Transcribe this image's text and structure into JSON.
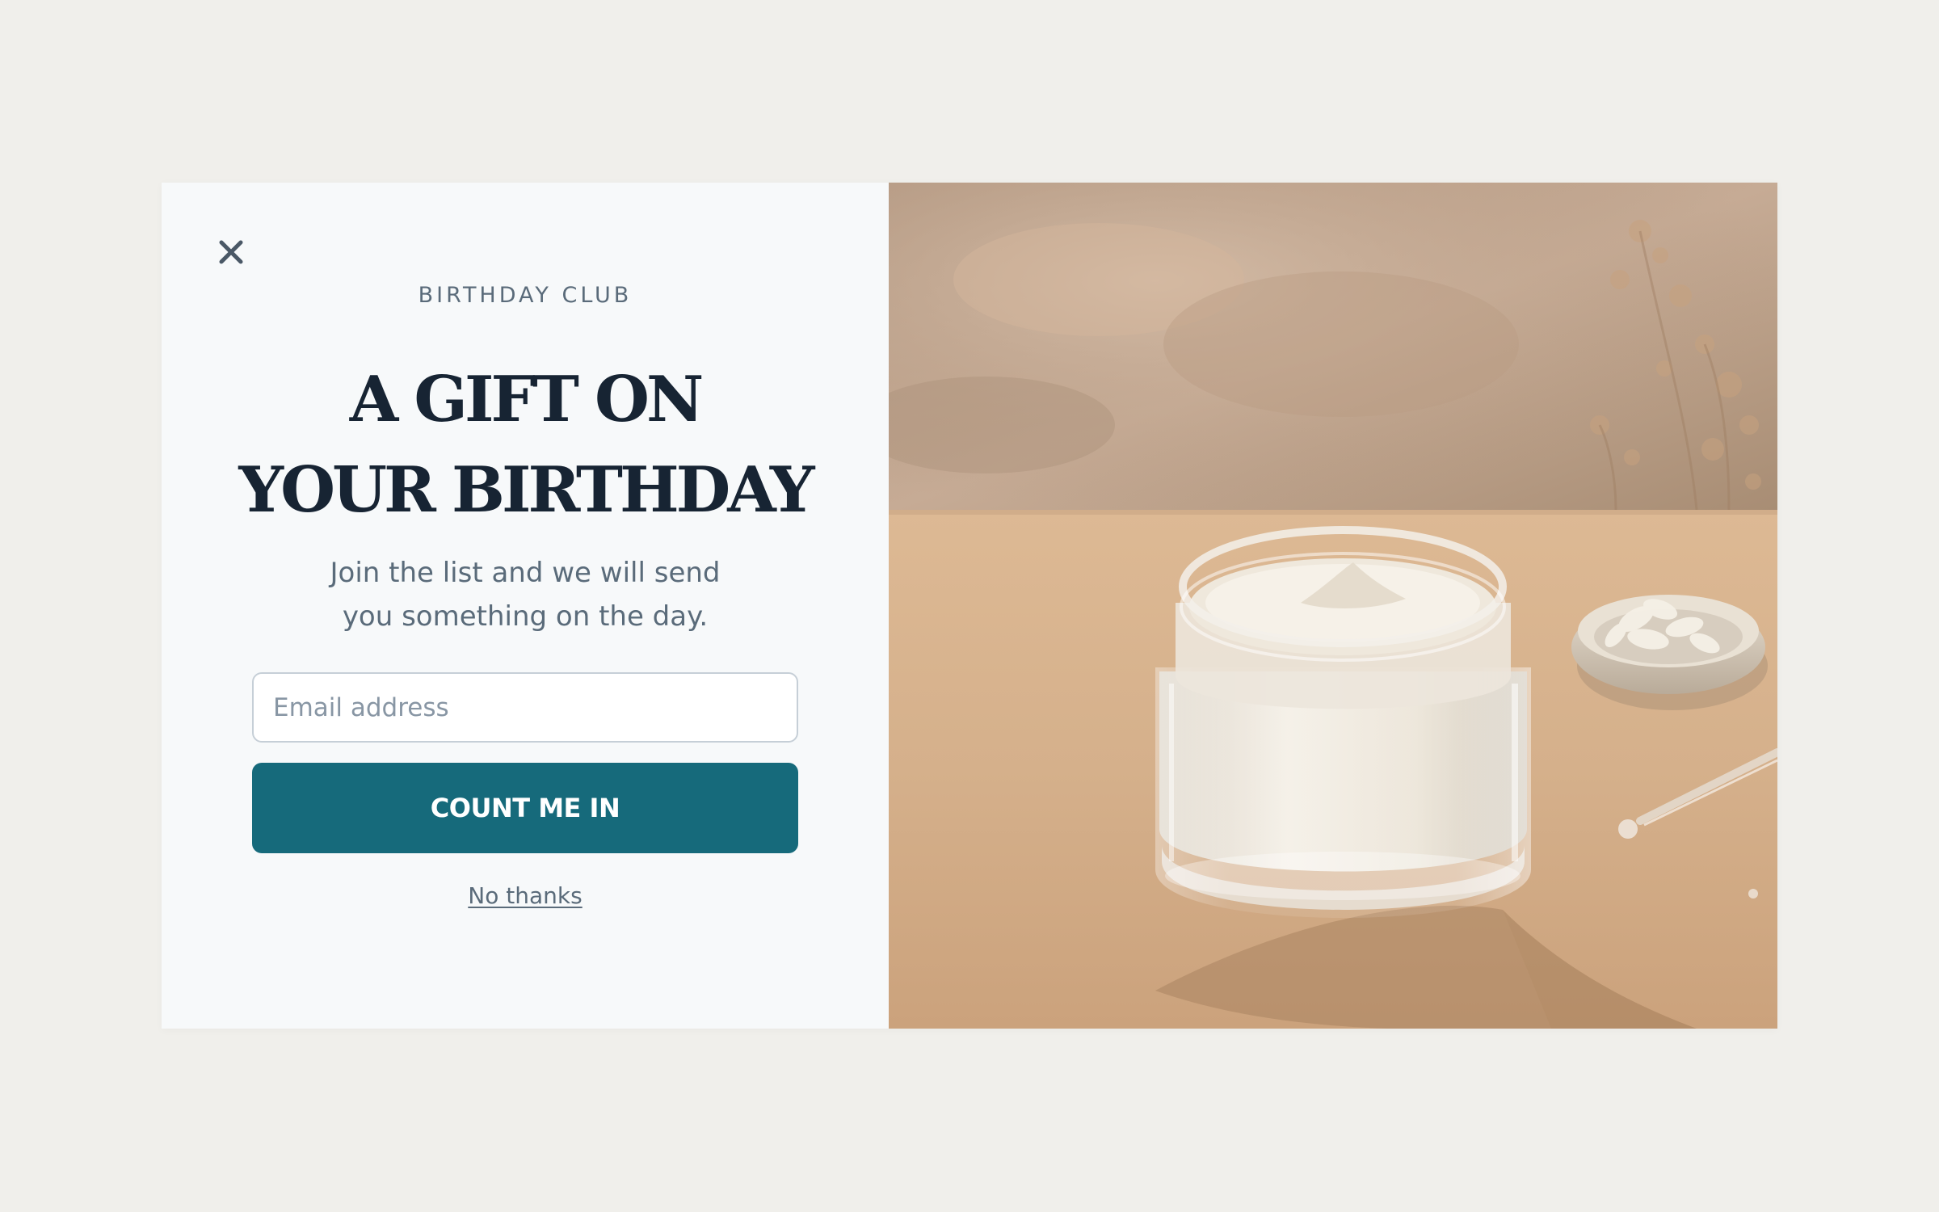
{
  "popup": {
    "eyebrow": "BIRTHDAY CLUB",
    "headline_line1": "A GIFT ON",
    "headline_line2": "YOUR BIRTHDAY",
    "subtitle_line1": "Join the list and we will send",
    "subtitle_line2": "you something on the day.",
    "email_placeholder": "Email address",
    "email_value": "",
    "cta_label": "COUNT ME IN",
    "dismiss_label": "No thanks"
  },
  "icons": {
    "close": "close-icon"
  },
  "colors": {
    "page_background": "#f0efeb",
    "panel_background": "#f7f9fa",
    "headline": "#172433",
    "muted_text": "#5a6b7a",
    "cta_background": "#166a7b",
    "cta_text": "#ffffff",
    "input_border": "#c6cfd7"
  }
}
